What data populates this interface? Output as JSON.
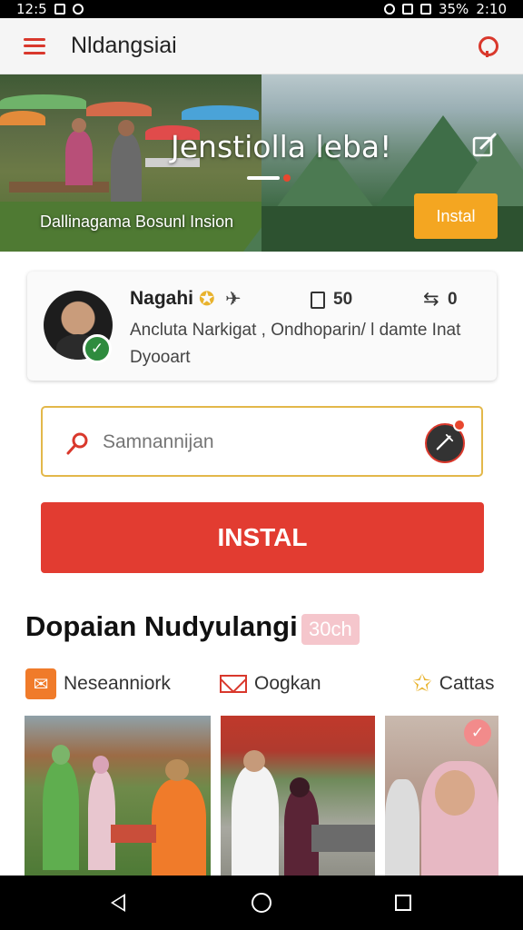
{
  "statusbar": {
    "time_left": "12:5",
    "battery": "35%",
    "time_right": "2:10"
  },
  "appbar": {
    "title": "Nldangsiai",
    "menu_icon": "hamburger-menu-icon",
    "search_icon": "search-icon"
  },
  "hero": {
    "headline": "Jenstiolla leba!",
    "caption": "Dallinagama Bosunl Insion",
    "install_label": "Instal",
    "edit_icon": "edit-icon"
  },
  "profile": {
    "name": "Nagahi",
    "doc_count": "50",
    "share_count": "0",
    "description": "Ancluta Narkigat , Ondhoparin/ l damte Inat Dyooart",
    "verified_icon": "check-icon"
  },
  "search": {
    "placeholder": "Samnannijan",
    "mic_icon": "microphone-icon"
  },
  "install_button": {
    "label": "INSTAL"
  },
  "section": {
    "title": "Dopaian Nudyulangi",
    "badge": "30ch"
  },
  "tabs": [
    {
      "label": "Neseanniork",
      "icon": "tag-icon"
    },
    {
      "label": "Oogkan",
      "icon": "mail-icon"
    },
    {
      "label": "Cattas",
      "icon": "star-icon"
    }
  ],
  "colors": {
    "primary": "#e23c31",
    "accent": "#f4a621",
    "badge": "#f5c6cc"
  }
}
